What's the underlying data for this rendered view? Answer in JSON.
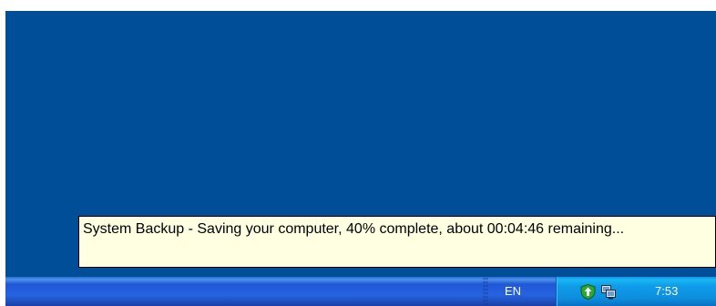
{
  "taskbar": {
    "language_indicator": "EN",
    "tray": {
      "icons": [
        "security-shield-icon",
        "network-icon"
      ],
      "clock": "7:53"
    }
  },
  "notification": {
    "message": "System Backup - Saving your computer, 40% complete, about 00:04:46 remaining...",
    "progress_percent": 40,
    "time_remaining": "00:04:46"
  },
  "colors": {
    "desktop_background": "#004e98",
    "taskbar_blue": "#2663e0",
    "tray_blue": "#0f9cea",
    "tooltip_background": "#ffffe1",
    "shield_green": "#2aa832"
  }
}
